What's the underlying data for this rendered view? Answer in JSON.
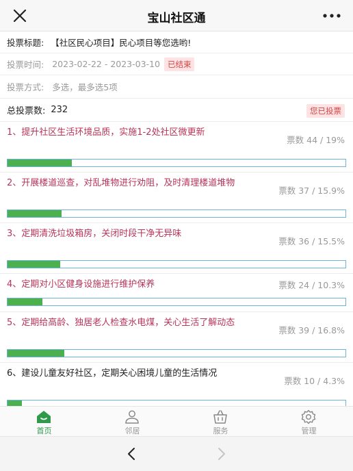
{
  "header": {
    "title": "宝山社区通"
  },
  "vote": {
    "title_label": "投票标题:",
    "title_value": "【社区民心项目】民心项目等您选哟!",
    "time_label": "投票时间:",
    "time_value": "2023-02-22 - 2023-03-10",
    "status_badge": "已结束",
    "method_label": "投票方式:",
    "method_value": "多选，最多选5项",
    "total_label": "总投票数:",
    "total_value": "232",
    "voted_badge": "您已投票"
  },
  "options": [
    {
      "text": "1、提升社区生活环境品质，实施1-2处社区微更新",
      "count": "票数 44 / 19%",
      "percent": 19,
      "highlight": true
    },
    {
      "text": "2、开展楼道巡查，对乱堆物进行劝阻，及时清理楼道堆物",
      "count": "票数 37 / 15.9%",
      "percent": 15.9,
      "highlight": true
    },
    {
      "text": "3、定期清洗垃圾箱房，关闭时段干净无异味",
      "count": "票数 36 / 15.5%",
      "percent": 15.5,
      "highlight": true
    },
    {
      "text": "4、定期对小区健身设施进行维护保养",
      "count": "票数 24 / 10.3%",
      "percent": 10.3,
      "highlight": true
    },
    {
      "text": "5、定期给高龄、独居老人检查水电煤，关心生活了解动态",
      "count": "票数 39 / 16.8%",
      "percent": 16.8,
      "highlight": true
    },
    {
      "text": "6、建设儿童友好社区，定期关心困境儿童的生活情况",
      "count": "票数 10 / 4.3%",
      "percent": 4.3,
      "highlight": false
    }
  ],
  "tabs": [
    {
      "label": "首页",
      "icon": "home-icon",
      "active": true
    },
    {
      "label": "邻居",
      "icon": "person-icon",
      "active": false
    },
    {
      "label": "服务",
      "icon": "basket-icon",
      "active": false
    },
    {
      "label": "管理",
      "icon": "gear-icon",
      "active": false
    }
  ],
  "colors": {
    "accent_green": "#2e9a4a",
    "option_text": "#b8345a",
    "bar_fill": "#4cb04c",
    "bar_border": "#6db4d8",
    "badge_text": "#d64545"
  }
}
